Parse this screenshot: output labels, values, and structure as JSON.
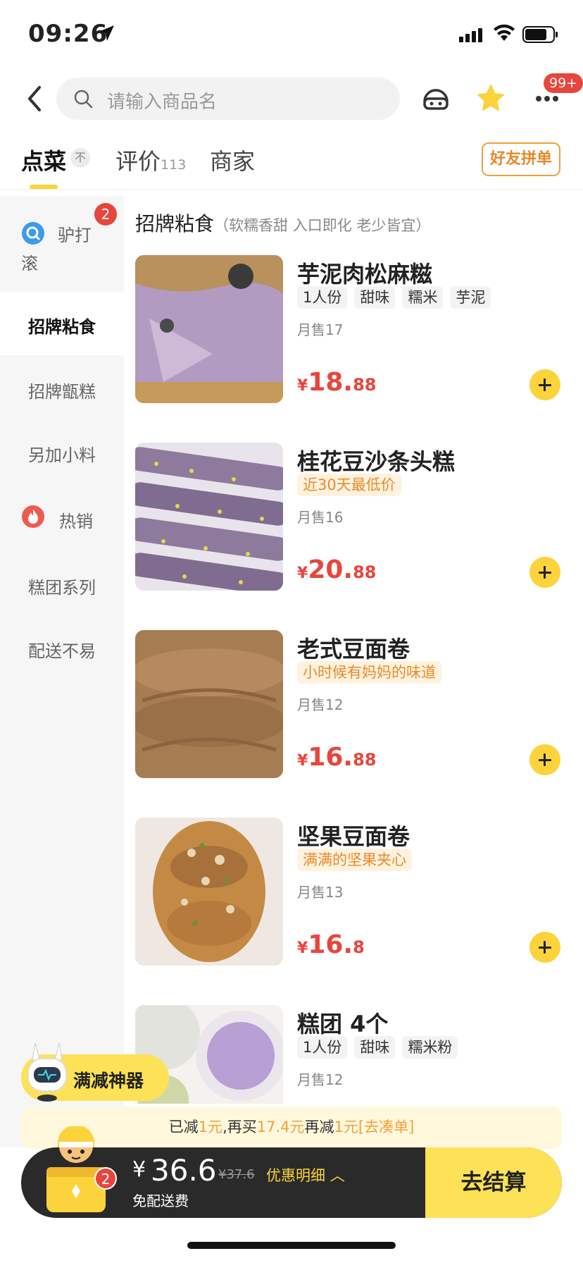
{
  "status_bar": {
    "time": "09:26"
  },
  "search": {
    "placeholder": "请输入商品名"
  },
  "header": {
    "more_badge": "99+"
  },
  "tabs": [
    {
      "label": "点菜",
      "sub": "",
      "active": true
    },
    {
      "label": "评价",
      "sub": "113",
      "active": false
    },
    {
      "label": "商家",
      "sub": "",
      "active": false
    }
  ],
  "tab_top_badge": "不",
  "friend_group_button": "好友拼单",
  "sidebar": {
    "items": [
      {
        "label": "驴打滚",
        "badge": "2",
        "icon": "search-circle-icon"
      },
      {
        "label": "招牌粘食",
        "active": true
      },
      {
        "label": "招牌甑糕"
      },
      {
        "label": "另加小料"
      },
      {
        "label": "热销",
        "icon": "flame-icon"
      },
      {
        "label": "糕团系列"
      },
      {
        "label": "配送不易"
      }
    ]
  },
  "category": {
    "title": "招牌粘食",
    "desc": "（软糯香甜 入口即化 老少皆宜）"
  },
  "items": [
    {
      "name": "芋泥肉松麻糍",
      "tags": [
        "1人份",
        "甜味",
        "糯米",
        "芋泥"
      ],
      "promo": "",
      "sales": "月售17",
      "price_int": "18.",
      "price_dec": "88"
    },
    {
      "name": "桂花豆沙条头糕",
      "tags": [],
      "promo": "近30天最低价",
      "sales": "月售16",
      "price_int": "20.",
      "price_dec": "88"
    },
    {
      "name": "老式豆面卷",
      "tags": [],
      "promo": "小时候有妈妈的味道",
      "sales": "月售12",
      "price_int": "16.",
      "price_dec": "88"
    },
    {
      "name": "坚果豆面卷",
      "tags": [],
      "promo": "满满的坚果夹心",
      "sales": "月售13",
      "price_int": "16.",
      "price_dec": "8"
    },
    {
      "name": "糕团 4个",
      "tags": [
        "1人份",
        "甜味",
        "糯米粉"
      ],
      "promo": "",
      "sales": "月售12",
      "price_int": "",
      "price_dec": ""
    }
  ],
  "currency": "¥",
  "shenqi": {
    "label": "满减神器"
  },
  "notice": {
    "p1": "已减",
    "v1": "1元",
    "p2": ",再买",
    "v2": "17.4元",
    "p3": "再减",
    "v3": "1元",
    "v4": "[去凑单]"
  },
  "cart": {
    "currency": "¥",
    "total": "36.6",
    "original": "¥37.6",
    "detail": "优惠明细",
    "free_delivery": "免配送费",
    "checkout": "去结算",
    "badge": "2"
  },
  "colors": {
    "accent": "#fcd33b",
    "price": "#e8453c",
    "promo": "#e9892b"
  }
}
